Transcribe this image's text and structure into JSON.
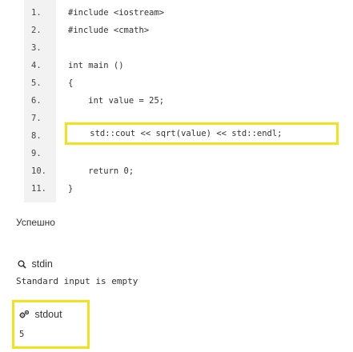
{
  "code": {
    "lines": [
      {
        "num": "1.",
        "text": "#include <iostream>"
      },
      {
        "num": "2.",
        "text": "#include <cmath>"
      },
      {
        "num": "3.",
        "text": ""
      },
      {
        "num": "4.",
        "text": "int main ()"
      },
      {
        "num": "5.",
        "text": "{"
      },
      {
        "num": "6.",
        "text": "    int value = 25;"
      },
      {
        "num": "7.",
        "text": ""
      },
      {
        "num": "8.",
        "text": "    std::cout << sqrt(value) << std::endl;"
      },
      {
        "num": "9.",
        "text": ""
      },
      {
        "num": "10.",
        "text": "    return 0;"
      },
      {
        "num": "11.",
        "text": "}"
      }
    ]
  },
  "status": "Успешно",
  "stdin": {
    "icon": "search-icon",
    "label": "stdin",
    "message": "Standard input is empty"
  },
  "stdout": {
    "icon": "gears-icon",
    "label": "stdout",
    "value": "5"
  },
  "colors": {
    "highlight": "#f3e21b",
    "gutter": "#f2f2f2"
  }
}
